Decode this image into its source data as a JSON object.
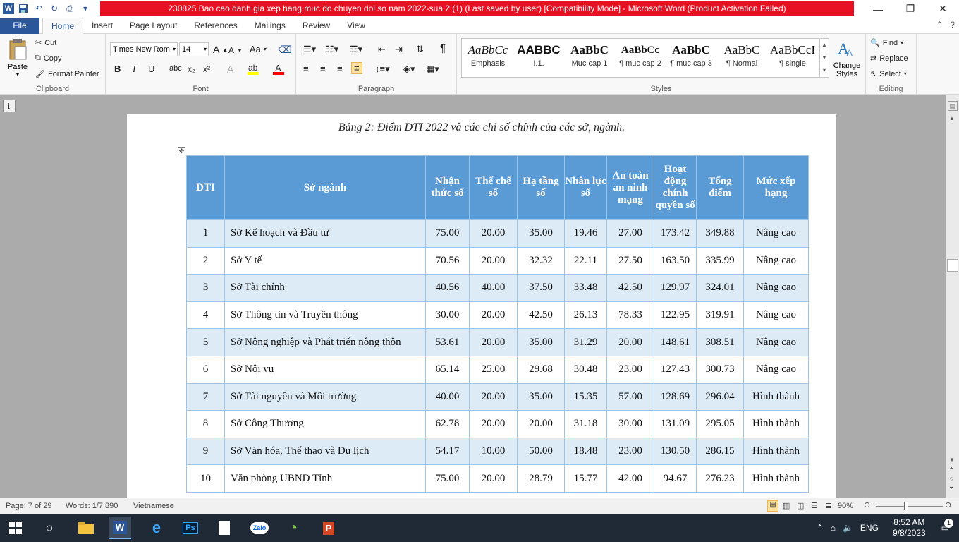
{
  "window": {
    "title": "230825 Bao cao danh gia xep hang muc do chuyen doi so nam 2022-sua 2 (1) (Last saved by user) [Compatibility Mode]  -  Microsoft Word (Product Activation Failed)",
    "help": "?",
    "minimize": "—",
    "restore": "❐",
    "close": "✕"
  },
  "ribbon_tabs": {
    "file": "File",
    "items": [
      "Home",
      "Insert",
      "Page Layout",
      "References",
      "Mailings",
      "Review",
      "View"
    ]
  },
  "clipboard": {
    "paste": "Paste",
    "cut": "Cut",
    "copy": "Copy",
    "format_painter": "Format Painter",
    "label": "Clipboard"
  },
  "font": {
    "family": "Times New Rom",
    "size": "14",
    "grow": "A",
    "shrink": "A",
    "case": "Aa",
    "bold": "B",
    "italic": "I",
    "underline": "U",
    "strike": "abc",
    "subscript": "x₂",
    "superscript": "x²",
    "label": "Font"
  },
  "paragraph": {
    "label": "Paragraph",
    "pilcrow": "¶"
  },
  "styles": {
    "label": "Styles",
    "items": [
      {
        "sample": "AaBbCc",
        "name": "Emphasis"
      },
      {
        "sample": "AABBC",
        "name": "I.1."
      },
      {
        "sample": "AaBbC",
        "name": "Muc cap 1"
      },
      {
        "sample": "AaBbCc",
        "name": "¶ muc cap 2"
      },
      {
        "sample": "AaBbC",
        "name": "¶ muc cap 3"
      },
      {
        "sample": "AaBbC",
        "name": "¶ Normal"
      },
      {
        "sample": "AaBbCcI",
        "name": "¶ single"
      }
    ],
    "change_styles_1": "Change",
    "change_styles_2": "Styles"
  },
  "editing": {
    "find": "Find",
    "replace": "Replace",
    "select": "Select",
    "label": "Editing"
  },
  "document": {
    "caption": "Bảng 2: Điểm DTI 2022 và các chỉ số chính của các sở, ngành.",
    "headers": [
      "DTI",
      "Sở ngành",
      "Nhận thức số",
      "Thể chế số",
      "Hạ tầng số",
      "Nhân lực số",
      "An toàn an ninh mạng",
      "Hoạt động chính quyền số",
      "Tổng điểm",
      "Mức xếp hạng"
    ],
    "rows": [
      [
        "1",
        "Sở Kế hoạch và Đầu tư",
        "75.00",
        "20.00",
        "35.00",
        "19.46",
        "27.00",
        "173.42",
        "349.88",
        "Nâng cao"
      ],
      [
        "2",
        "Sở Y tế",
        "70.56",
        "20.00",
        "32.32",
        "22.11",
        "27.50",
        "163.50",
        "335.99",
        "Nâng cao"
      ],
      [
        "3",
        "Sở Tài chính",
        "40.56",
        "40.00",
        "37.50",
        "33.48",
        "42.50",
        "129.97",
        "324.01",
        "Nâng cao"
      ],
      [
        "4",
        "Sở Thông tin và Truyền thông",
        "30.00",
        "20.00",
        "42.50",
        "26.13",
        "78.33",
        "122.95",
        "319.91",
        "Nâng cao"
      ],
      [
        "5",
        "Sở Nông nghiệp và Phát triển nông thôn",
        "53.61",
        "20.00",
        "35.00",
        "31.29",
        "20.00",
        "148.61",
        "308.51",
        "Nâng cao"
      ],
      [
        "6",
        "Sở Nội vụ",
        "65.14",
        "25.00",
        "29.68",
        "30.48",
        "23.00",
        "127.43",
        "300.73",
        "Nâng cao"
      ],
      [
        "7",
        "Sở Tài nguyên và Môi trường",
        "40.00",
        "20.00",
        "35.00",
        "15.35",
        "57.00",
        "128.69",
        "296.04",
        "Hình thành"
      ],
      [
        "8",
        "Sở Công Thương",
        "62.78",
        "20.00",
        "20.00",
        "31.18",
        "30.00",
        "131.09",
        "295.05",
        "Hình thành"
      ],
      [
        "9",
        "Sở Văn hóa, Thể thao và Du lịch",
        "54.17",
        "10.00",
        "50.00",
        "18.48",
        "23.00",
        "130.50",
        "286.15",
        "Hình thành"
      ],
      [
        "10",
        "Văn phòng UBND Tỉnh",
        "75.00",
        "20.00",
        "28.79",
        "15.77",
        "42.00",
        "94.67",
        "276.23",
        "Hình thành"
      ]
    ]
  },
  "status": {
    "page": "Page: 7 of 29",
    "words": "Words: 1/7,890",
    "language": "Vietnamese",
    "zoom": "90%"
  },
  "taskbar": {
    "language": "ENG",
    "time": "8:52 AM",
    "date": "9/8/2023",
    "notifications": "1"
  }
}
